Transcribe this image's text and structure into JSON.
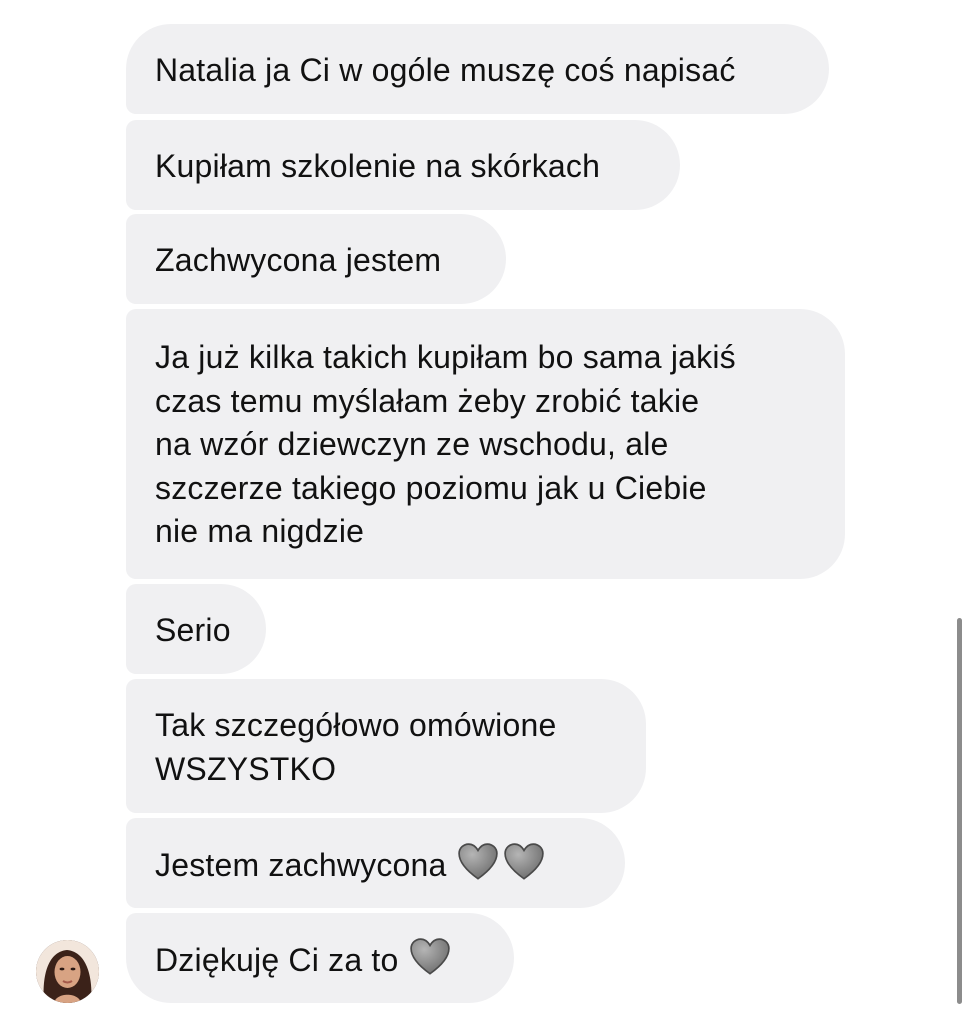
{
  "messages": [
    {
      "text": "Natalia ja Ci w ogóle muszę coś napisać"
    },
    {
      "text": "Kupiłam szkolenie na skórkach"
    },
    {
      "text": "Zachwycona jestem"
    },
    {
      "text": "Ja już kilka takich kupiłam bo sama jakiś\nczas temu myślałam żeby zrobić takie\nna wzór dziewczyn ze wschodu, ale\nszczerze takiego poziomu jak u Ciebie\nnie ma nigdzie"
    },
    {
      "text": "Serio"
    },
    {
      "text": "Tak szczegółowo omówione\nWSZYSTKO"
    },
    {
      "text": "Jestem zachwycona",
      "emoji": [
        "grey-heart-icon",
        "grey-heart-icon"
      ]
    },
    {
      "text": "Dziękuję Ci za to",
      "emoji": [
        "grey-heart-icon"
      ]
    }
  ],
  "colors": {
    "bubble_bg": "#f0f0f2",
    "text": "#111111",
    "heart": "#8a8a8a",
    "scrollbar": "#8c8c8c"
  },
  "avatar": {
    "icon": "profile-photo"
  }
}
